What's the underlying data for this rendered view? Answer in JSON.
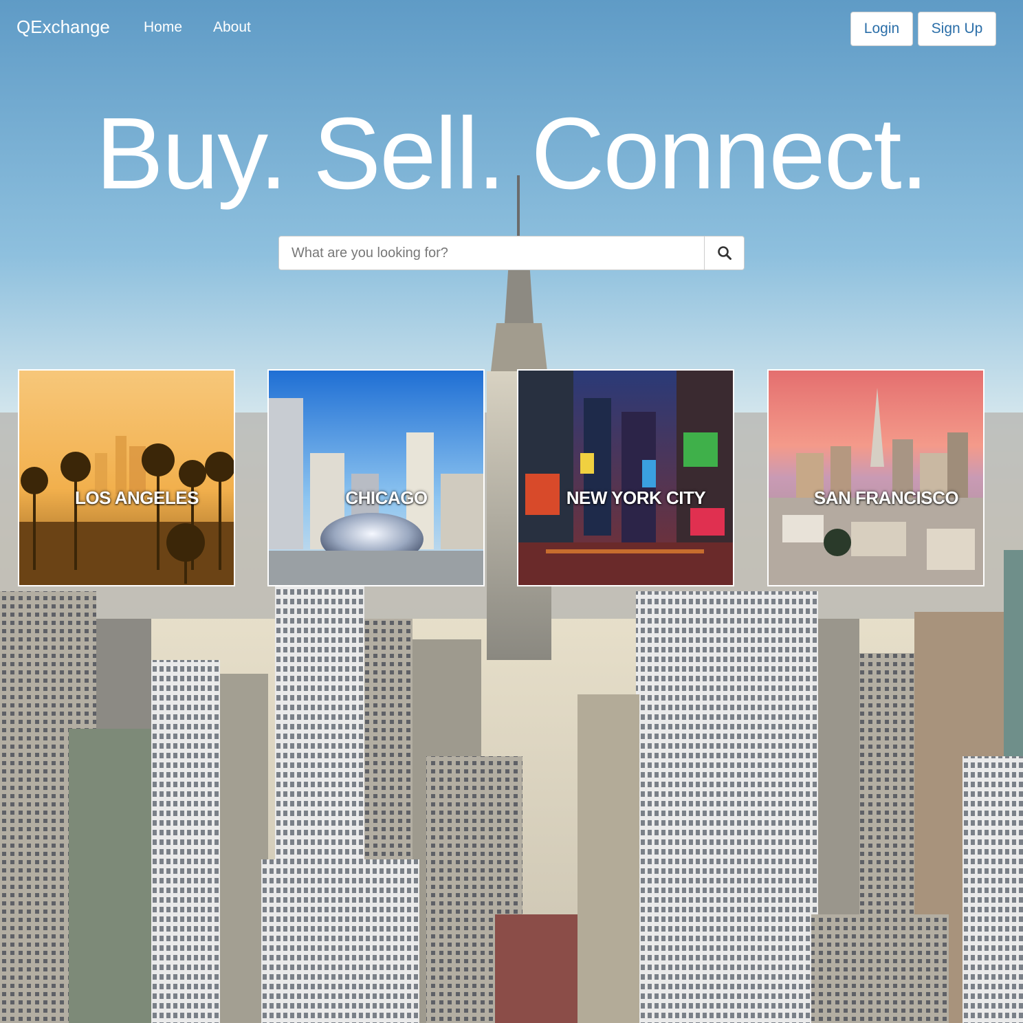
{
  "nav": {
    "brand": "QExchange",
    "links": [
      {
        "label": "Home"
      },
      {
        "label": "About"
      }
    ],
    "login_label": "Login",
    "signup_label": "Sign Up"
  },
  "hero": {
    "title": "Buy. Sell. Connect."
  },
  "search": {
    "placeholder": "What are you looking for?",
    "button_icon": "search-icon"
  },
  "cities": [
    {
      "label": "LOS ANGELES"
    },
    {
      "label": "CHICAGO"
    },
    {
      "label": "NEW YORK CITY"
    },
    {
      "label": "SAN FRANCISCO"
    }
  ],
  "colors": {
    "accent": "#2a6ea8",
    "text_on_image": "#ffffff"
  }
}
